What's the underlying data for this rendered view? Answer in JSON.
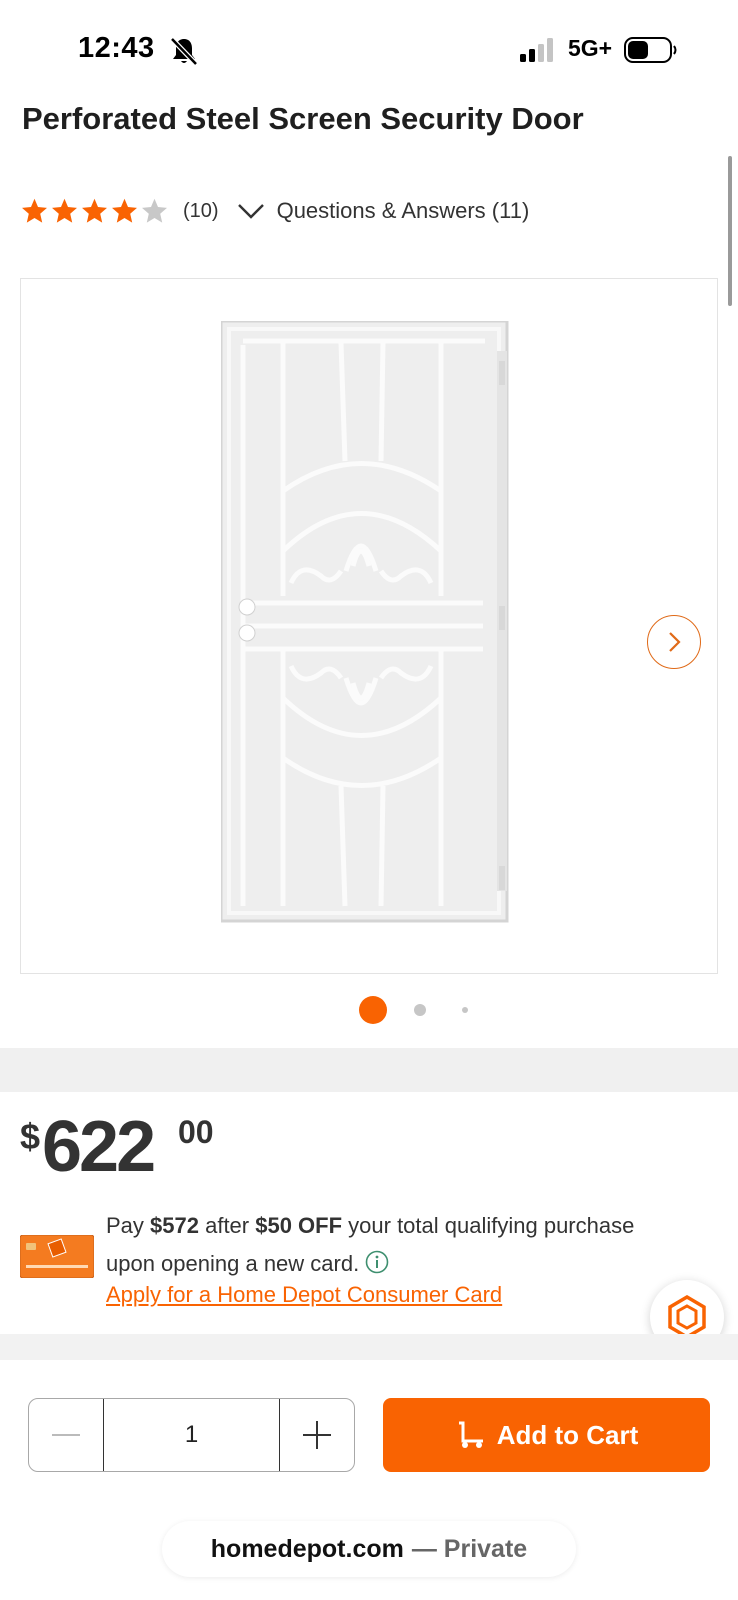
{
  "status_bar": {
    "time": "12:43",
    "network": "5G+",
    "icons": [
      "bell-slash-icon",
      "signal-icon",
      "battery-icon"
    ]
  },
  "product": {
    "title": "Perforated Steel Screen Security Door",
    "rating": 4,
    "rating_max": 5,
    "review_count": "(10)",
    "qa_label": "Questions & Answers (11)"
  },
  "gallery": {
    "image": "security-door-image",
    "current_index": 1,
    "total_dots": 3
  },
  "price": {
    "symbol": "$",
    "dollars": "622",
    "cents": "00"
  },
  "promo": {
    "line1_pre": "Pay ",
    "line1_amount": "$572",
    "line1_mid": " after ",
    "line1_off": "$50 OFF",
    "line1_post": " your total qualifying purchase",
    "line2": "upon opening a new card.",
    "apply_link": "Apply for a Home Depot Consumer Card"
  },
  "cart": {
    "quantity": "1",
    "add_to_cart_label": "Add to Cart"
  },
  "browser": {
    "domain": "homedepot.com",
    "separator_mode": "— Private"
  },
  "colors": {
    "brand_orange": "#f96302",
    "star_gray": "#c8c8c8"
  }
}
